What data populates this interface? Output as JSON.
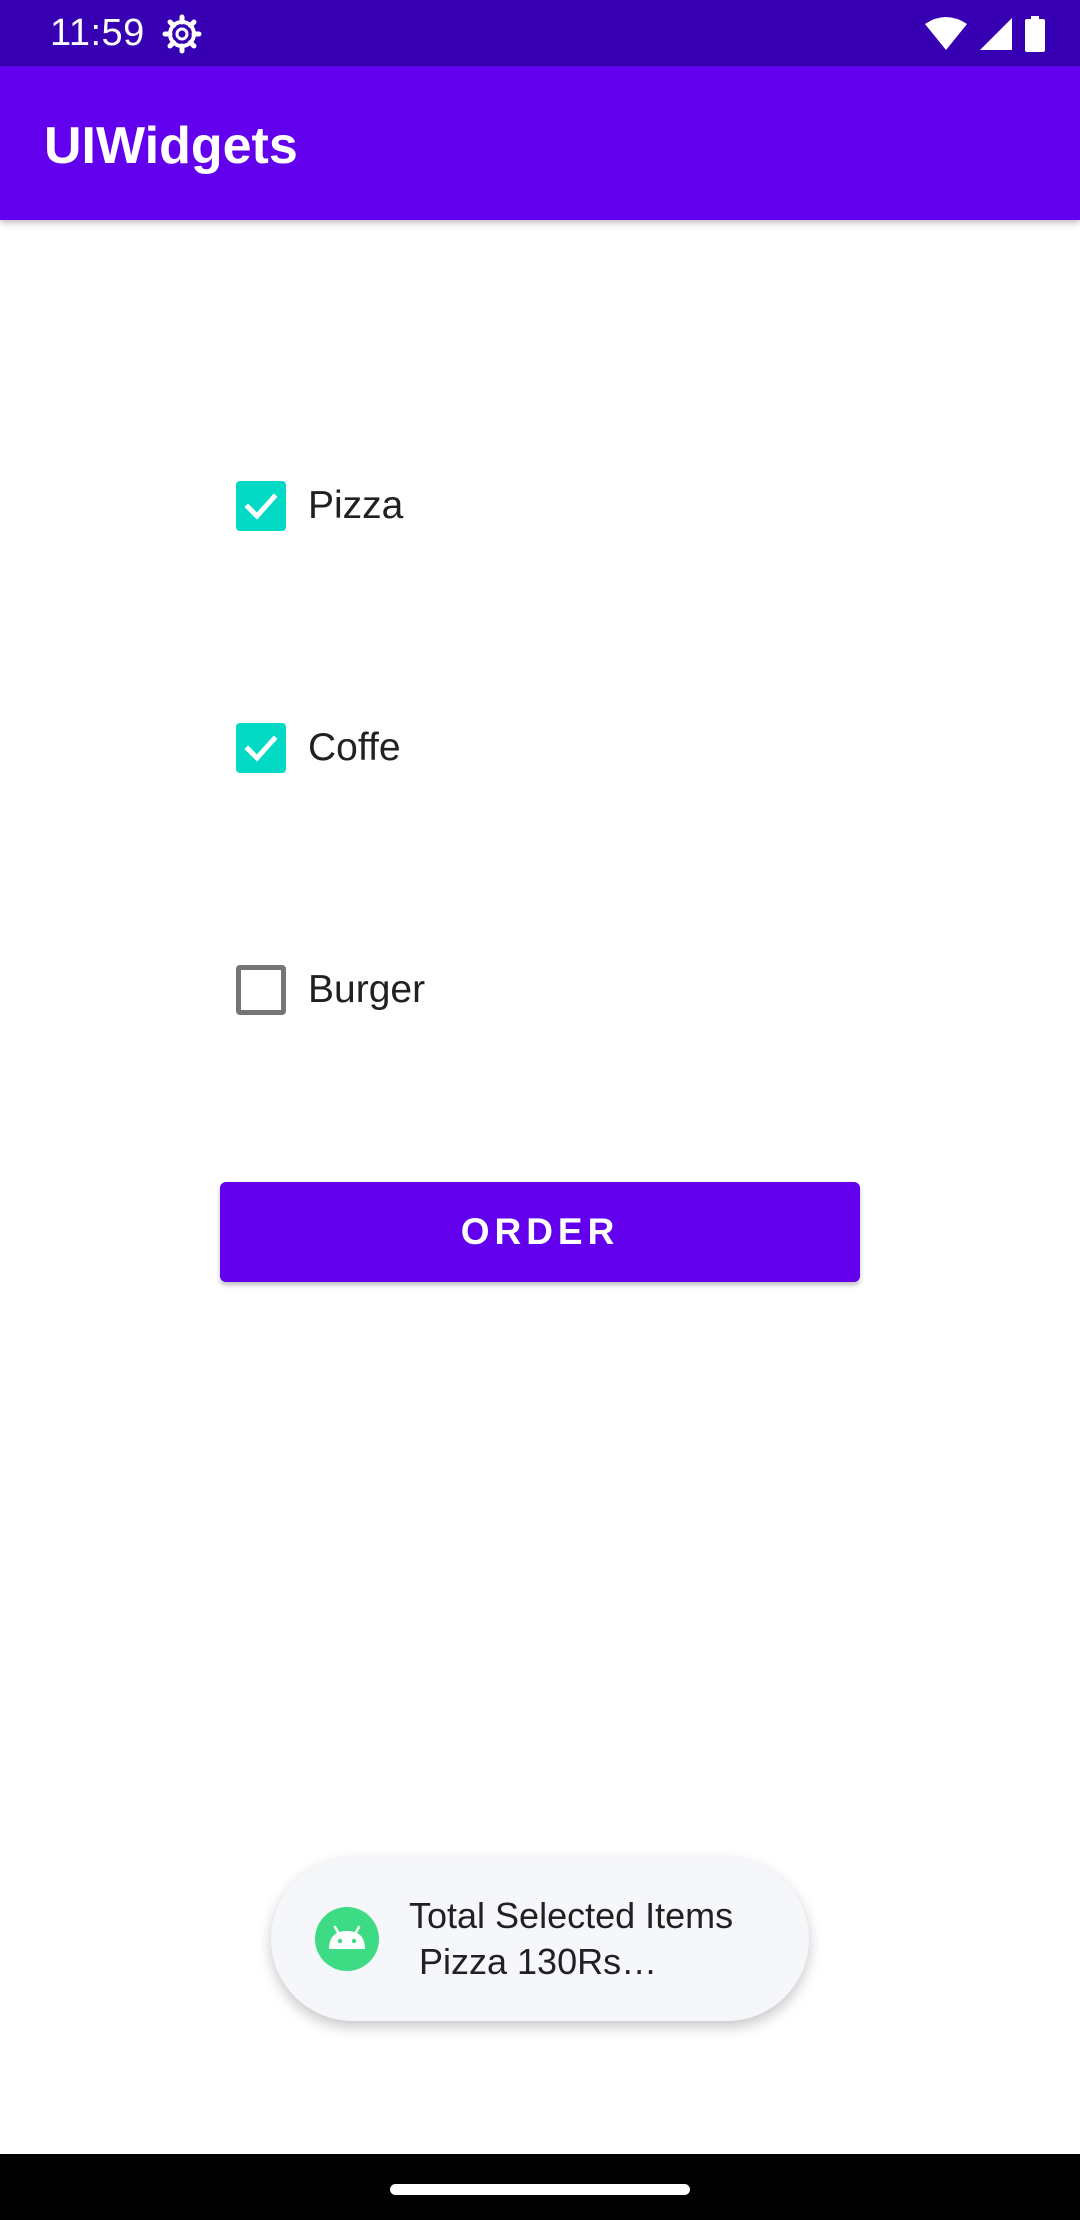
{
  "status_bar": {
    "time": "11:59",
    "icons": [
      "settings-gear-icon",
      "wifi-icon",
      "cell-signal-icon",
      "battery-icon"
    ],
    "color": "#3700b3"
  },
  "app_bar": {
    "title": "UIWidgets",
    "color": "#6200ee"
  },
  "items": [
    {
      "label": "Pizza",
      "checked": true
    },
    {
      "label": "Coffe",
      "checked": true
    },
    {
      "label": "Burger",
      "checked": false
    }
  ],
  "checkbox_accent": "#03dac5",
  "order_button": {
    "label": "ORDER",
    "color": "#6200ee"
  },
  "toast": {
    "icon": "android-icon",
    "line1": "Total Selected Items",
    "line2": " Pizza 130Rs…"
  }
}
